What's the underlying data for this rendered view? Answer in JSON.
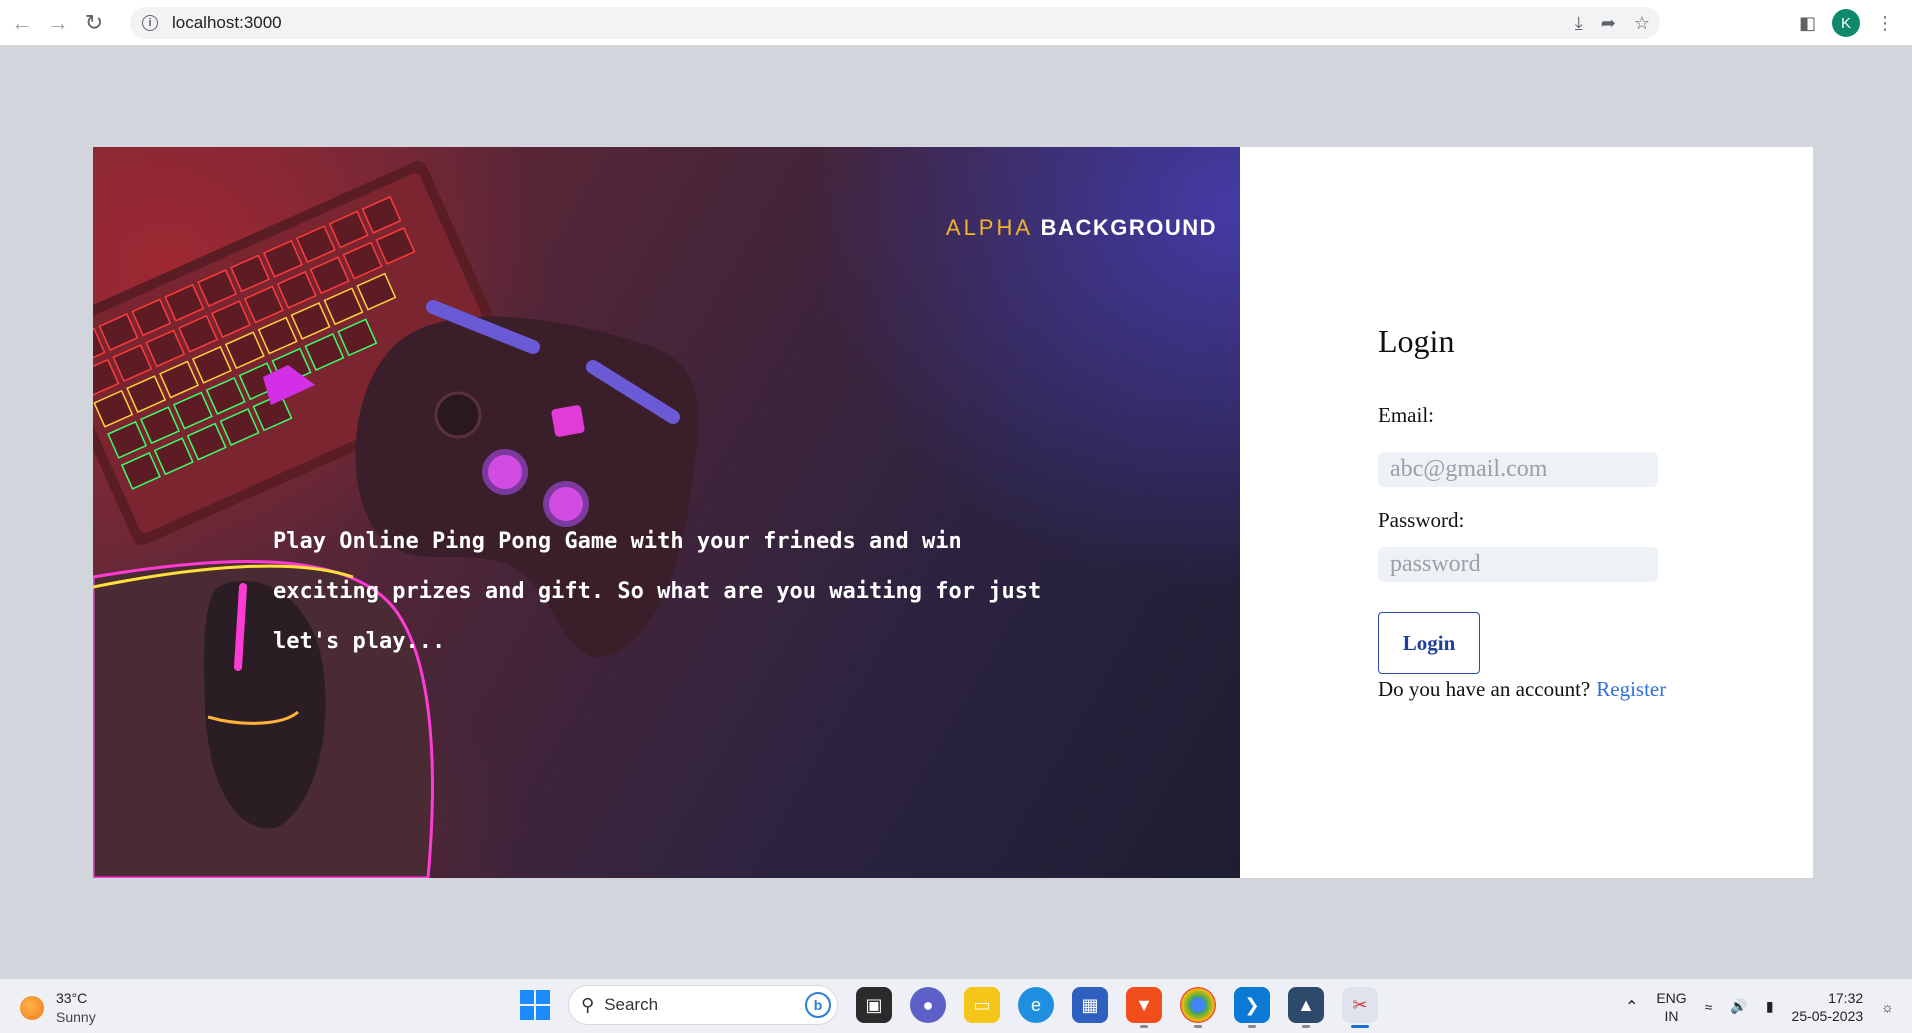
{
  "browser": {
    "url": "localhost:3000",
    "profile_initial": "K"
  },
  "hero": {
    "brand_light": "ALPHA",
    "brand_bold": "BACKGROUND",
    "tagline": "Play Online Ping Pong Game with your frineds and win exciting prizes and gift. So what are you waiting for just let's play..."
  },
  "login": {
    "title": "Login",
    "email_label": "Email:",
    "email_placeholder": "abc@gmail.com",
    "password_label": "Password:",
    "password_placeholder": "password",
    "button_label": "Login",
    "account_prompt": "Do you have an account?",
    "register_link": "Register"
  },
  "taskbar": {
    "temperature": "33°C",
    "condition": "Sunny",
    "search_label": "Search",
    "lang_line1": "ENG",
    "lang_line2": "IN",
    "time": "17:32",
    "date": "25-05-2023"
  },
  "colors": {
    "brand_accent": "#f0b429",
    "link": "#2f6fdb",
    "button_border": "#2b4fb0"
  }
}
